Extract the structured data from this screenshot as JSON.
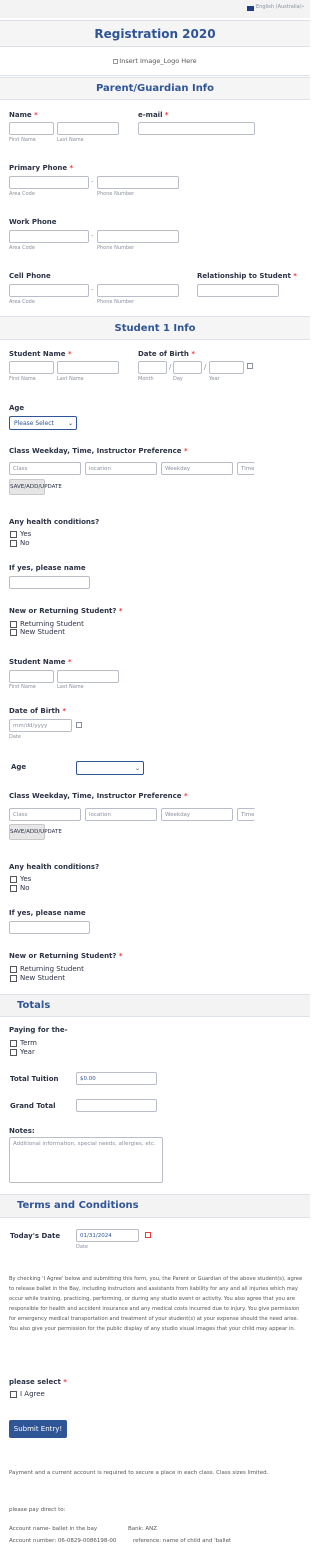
{
  "lang": {
    "label": "English (Australia)"
  },
  "form": {
    "title": "Registration 2020",
    "logo_alt": "Insert Image_Logo Here"
  },
  "sections": {
    "parent": "Parent/Guardian Info",
    "student1": "Student 1 Info",
    "totals": "Totals",
    "terms": "Terms and Conditions"
  },
  "parent": {
    "name_label": "Name",
    "email_label": "e-mail",
    "first_name": "First Name",
    "last_name": "Last Name",
    "primary_phone": "Primary Phone",
    "work_phone": "Work Phone",
    "cell_phone": "Cell Phone",
    "relationship": "Relationship to Student",
    "area_code": "Area Code",
    "phone_number": "Phone Number",
    "dash": "-"
  },
  "student": {
    "student_name": "Student Name",
    "dob": "Date of Birth",
    "month": "Month",
    "day": "Day",
    "year": "Year",
    "slash": "/",
    "age": "Age",
    "age_select": "Please Select",
    "class_pref": "Class Weekday, Time, Instructor Preference",
    "class_ph": "Class",
    "location_ph": "location",
    "weekday_ph": "Weekday",
    "time_ph": "Time",
    "save_btn": "SAVE/ADD/UPDATE",
    "health": "Any health conditions?",
    "yes": "Yes",
    "no": "No",
    "if_yes": "If yes, please name",
    "new_returning": "New or Returning Student?",
    "returning": "Returning Student",
    "new": "New Student",
    "dob_ph": "mm/dd/yyyy",
    "date": "Date"
  },
  "totals": {
    "paying_for": "Paying for the-",
    "term": "Term",
    "year": "Year",
    "total_tuition": "Total Tuition",
    "total_value": "$0.00",
    "grand_total": "Grand Total",
    "notes": "Notes:",
    "notes_ph": "Additional information, special needs, allergies, etc."
  },
  "terms": {
    "todays_date": "Today's Date",
    "date_value": "01/31/2024",
    "date_sub": "Date",
    "agreement": "By checking 'I Agree' below and submitting this form, you, the Parent or Guardian of the above student(s), agree to release ballet in the Bay, including instructors and assistants from liability for any and all injuries which may occur while training, practicing, performing, or during any studio event or activity. You also agree that you are responsible for health and accident insurance and any medical costs incurred due to injury. You give permission for emergency medical transportation and treatment of your student(s) at your expense should the need arise. You also give your permission for the public display of any studio visual images that your child may appear in.",
    "please_select": "please select",
    "i_agree": "I Agree",
    "submit": "Submit Entry!",
    "payment_note": "Payment and a current account is required to secure a place in each class. Class sizes limited.",
    "pay_direct": "please pay direct to:",
    "account_name": "Account name- ballet in the bay",
    "bank": "Bank: ANZ",
    "account_number": "Account number: 06-0829-0086198-00",
    "reference": "reference: name of child and 'ballet"
  }
}
